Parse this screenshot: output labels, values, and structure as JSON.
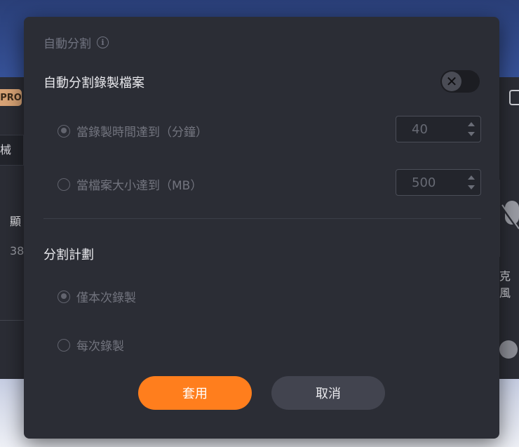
{
  "background": {
    "pro_badge": "PRO",
    "field_fragment": "械",
    "label_fragment": "顯",
    "number_fragment": "38",
    "right_label_fragment": "克風"
  },
  "dialog": {
    "title": "自動分割",
    "info_icon": "info-icon",
    "auto_split_label": "自動分割錄製檔案",
    "toggle_state": "off",
    "options": [
      {
        "label": "當錄製時間達到（分鐘）",
        "checked": true,
        "value": "40"
      },
      {
        "label": "當檔案大小達到（MB）",
        "checked": false,
        "value": "500"
      }
    ],
    "plan_title": "分割計劃",
    "plan_options": [
      {
        "label": "僅本次錄製",
        "checked": true
      },
      {
        "label": "每次錄製",
        "checked": false
      }
    ],
    "apply_label": "套用",
    "cancel_label": "取消"
  },
  "colors": {
    "accent": "#ff7e1d",
    "dialog_bg": "#2b2d35",
    "secondary_button": "#42444f"
  }
}
